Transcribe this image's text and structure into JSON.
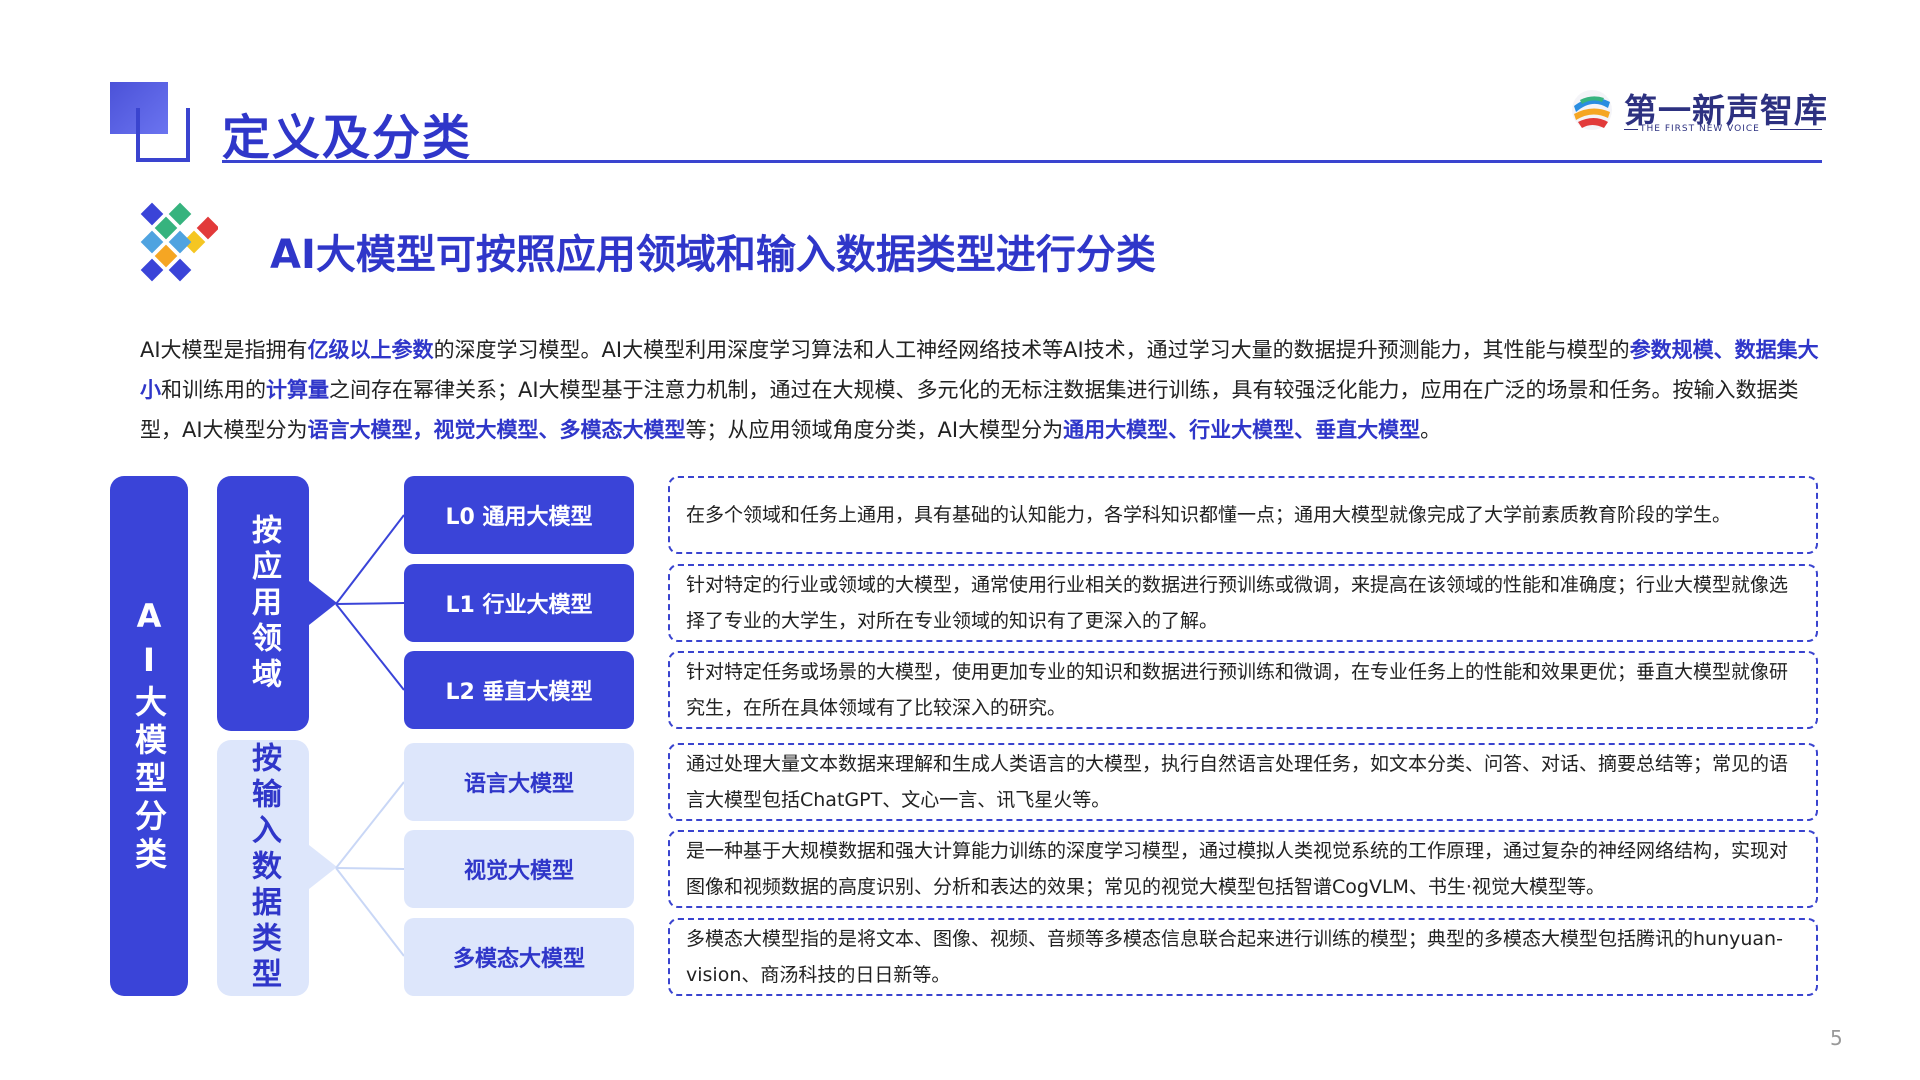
{
  "header": {
    "title": "定义及分类",
    "logo_name": "第一新声智库",
    "logo_sub": "THE FIRST NEW VOICE"
  },
  "subtitle": "AI大模型可按照应用领域和输入数据类型进行分类",
  "intro": [
    {
      "t": "AI大模型是指拥有",
      "h": false
    },
    {
      "t": "亿级以上参数",
      "h": true
    },
    {
      "t": "的深度学习模型。AI大模型利用深度学习算法和人工神经网络技术等AI技术，通过学习大量的数据提升预测能力，其性能与模型的",
      "h": false
    },
    {
      "t": "参数规模、数据集大小",
      "h": true
    },
    {
      "t": "和训练用的",
      "h": false
    },
    {
      "t": "计算量",
      "h": true
    },
    {
      "t": "之间存在幂律关系；AI大模型基于注意力机制，通过在大规模、多元化的无标注数据集进行训练，具有较强泛化能力，应用在广泛的场景和任务。按输入数据类型，AI大模型分为",
      "h": false
    },
    {
      "t": "语言大模型，视觉大模型、多模态大模型",
      "h": true
    },
    {
      "t": "等；从应用领域角度分类，AI大模型分为",
      "h": false
    },
    {
      "t": "通用大模型、行业大模型、垂直大模型",
      "h": true
    },
    {
      "t": "。",
      "h": false
    }
  ],
  "categories": {
    "main": "AI大模型分类",
    "by_application": "按应用领域",
    "by_input": "按输入数据类型"
  },
  "models": [
    {
      "label": "L0  通用大模型",
      "desc": "在多个领域和任务上通用，具有基础的认知能力，各学科知识都懂一点；通用大模型就像完成了大学前素质教育阶段的学生。"
    },
    {
      "label": "L1  行业大模型",
      "desc": "针对特定的行业或领域的大模型，通常使用行业相关的数据进行预训练或微调，来提高在该领域的性能和准确度；行业大模型就像选择了专业的大学生，对所在专业领域的知识有了更深入的了解。"
    },
    {
      "label": "L2  垂直大模型",
      "desc": "针对特定任务或场景的大模型，使用更加专业的知识和数据进行预训练和微调，在专业任务上的性能和效果更优；垂直大模型就像研究生，在所在具体领域有了比较深入的研究。"
    },
    {
      "label": "语言大模型",
      "desc": "通过处理大量文本数据来理解和生成人类语言的大模型，执行自然语言处理任务，如文本分类、问答、对话、摘要总结等；常见的语言大模型包括ChatGPT、文心一言、讯飞星火等。"
    },
    {
      "label": "视觉大模型",
      "desc": "是一种基于大规模数据和强大计算能力训练的深度学习模型，通过模拟人类视觉系统的工作原理，通过复杂的神经网络结构，实现对图像和视频数据的高度识别、分析和表达的效果；常见的视觉大模型包括智谱CogVLM、书生·视觉大模型等。"
    },
    {
      "label": "多模态大模型",
      "desc": "多模态大模型指的是将文本、图像、视频、音频等多模态信息联合起来进行训练的模型；典型的多模态大模型包括腾讯的hunyuan-vision、商汤科技的日日新等。"
    }
  ],
  "page_number": "5",
  "colors": {
    "accent": "#3a44d8",
    "accent_light": "#dde6fb",
    "title": "#2f36c9"
  }
}
